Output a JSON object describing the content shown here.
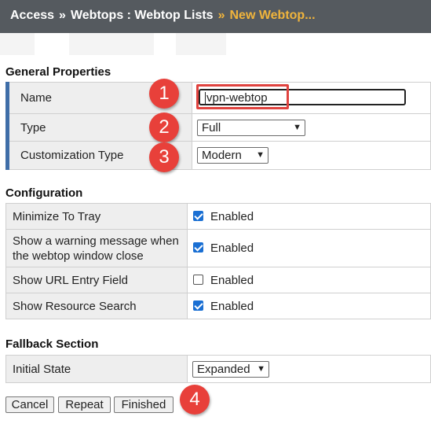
{
  "breadcrumb": {
    "items": [
      "Access",
      "Webtops : Webtop Lists",
      "New Webtop..."
    ],
    "separator": "»"
  },
  "general": {
    "title": "General Properties",
    "name_label": "Name",
    "name_value": "vpn-webtop",
    "type_label": "Type",
    "type_value": "Full",
    "customization_label": "Customization Type",
    "customization_value": "Modern"
  },
  "configuration": {
    "title": "Configuration",
    "rows": [
      {
        "label": "Minimize To Tray",
        "checked": true,
        "value": "Enabled"
      },
      {
        "label": "Show a warning message when the webtop window close",
        "checked": true,
        "value": "Enabled"
      },
      {
        "label": "Show URL Entry Field",
        "checked": false,
        "value": "Enabled"
      },
      {
        "label": "Show Resource Search",
        "checked": true,
        "value": "Enabled"
      }
    ]
  },
  "fallback": {
    "title": "Fallback Section",
    "initial_state_label": "Initial State",
    "initial_state_value": "Expanded"
  },
  "buttons": {
    "cancel": "Cancel",
    "repeat": "Repeat",
    "finished": "Finished"
  },
  "annotations": [
    "1",
    "2",
    "3",
    "4"
  ],
  "colors": {
    "header_bg": "#555a5f",
    "breadcrumb_active": "#f0b43c",
    "section_bar": "#3f6ea8",
    "highlight": "#e0433f",
    "badge": "#e8403a",
    "checkbox": "#1a6fd3"
  }
}
